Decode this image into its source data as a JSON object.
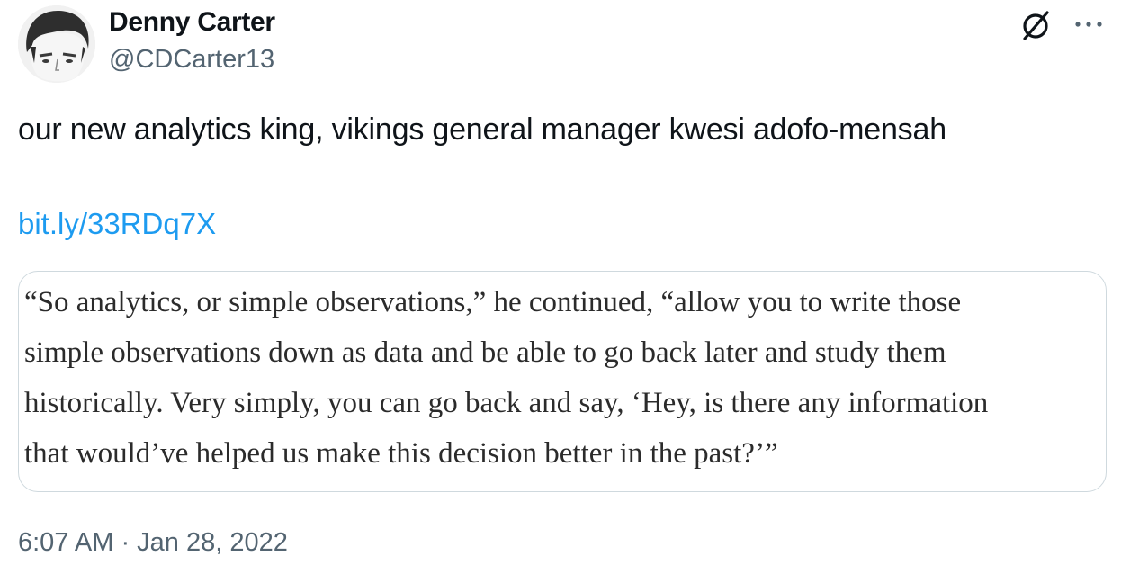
{
  "author": {
    "name": "Denny Carter",
    "handle": "@CDCarter13"
  },
  "tweet": {
    "text": "our new analytics king, vikings general manager kwesi adofo-mensah",
    "link": "bit.ly/33RDq7X",
    "quote_lines": [
      "“So analytics, or simple observations,” he continued, “allow you to write those",
      "simple observations down as data and be able to go back later and study them",
      "historically. Very simply, you can go back and say, ‘Hey, is there any information",
      "that would’ve helped us make this decision better in the past?’”"
    ],
    "timestamp": "6:07 AM · Jan 28, 2022"
  },
  "icons": {
    "header_logo": "x-slash-icon",
    "more": "more-horizontal-icon"
  },
  "colors": {
    "text_primary": "#0f1419",
    "text_secondary": "#536471",
    "link": "#1d9bf0",
    "card_border": "#cfd9de"
  }
}
